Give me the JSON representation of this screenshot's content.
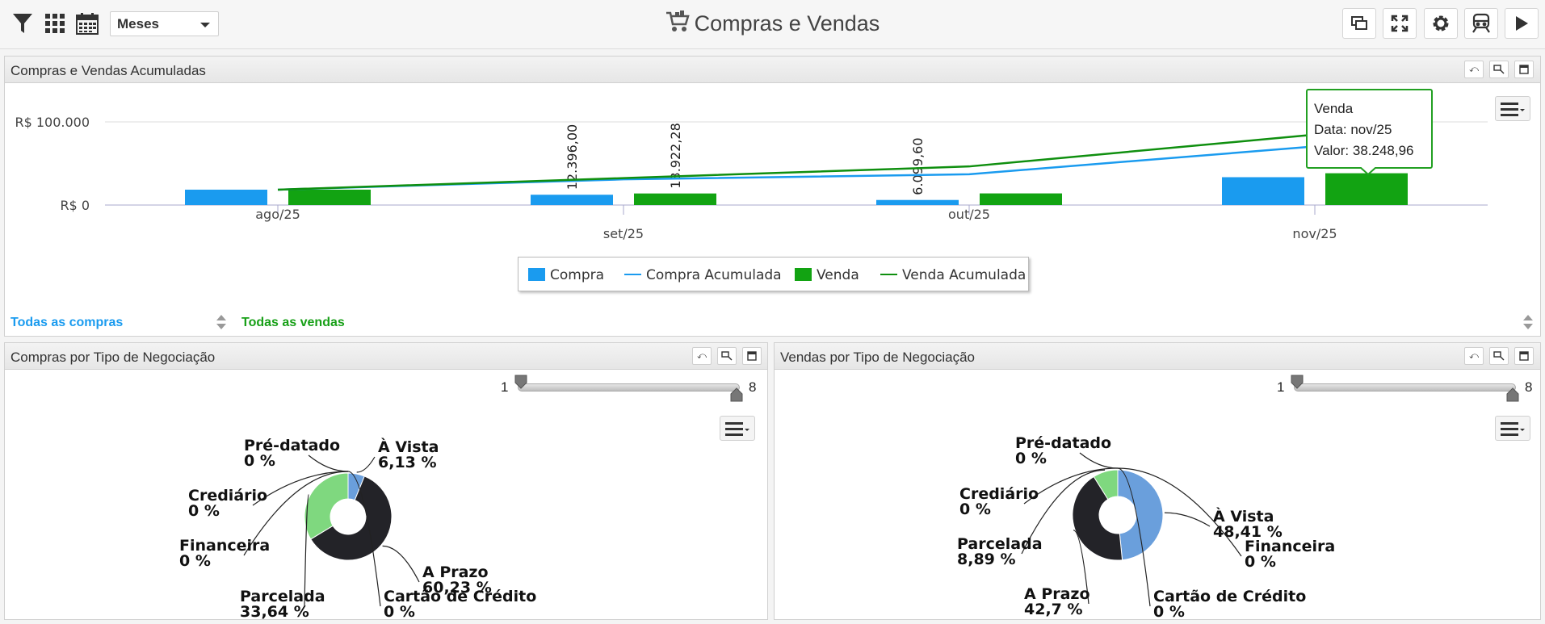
{
  "toolbar": {
    "period_select": "Meses",
    "title": "Compras e Vendas",
    "icons": [
      "filter-icon",
      "grid-icon",
      "calendar-icon",
      "cart-icon",
      "windows-icon",
      "fullscreen-icon",
      "gear-icon",
      "train-icon",
      "play-icon"
    ]
  },
  "panel_main": {
    "title": "Compras e Vendas Acumuladas",
    "link_compras": "Todas as compras",
    "link_vendas": "Todas as vendas"
  },
  "tooltip": {
    "series": "Venda",
    "data_label": "Data: nov/25",
    "valor_label": "Valor: 38.248,96"
  },
  "colors": {
    "compra": "#1a9bef",
    "compra_acumulada": "#1a9bef",
    "venda": "#12a312",
    "venda_acumulada": "#0f8f0f"
  },
  "chart_data": [
    {
      "type": "bar",
      "categories": [
        "ago/25",
        "set/25",
        "out/25",
        "nov/25"
      ],
      "yticks": [
        "R$ 0",
        "R$ 100.000"
      ],
      "ylim": [
        0,
        100000
      ],
      "series": [
        {
          "name": "Compra",
          "type": "bar",
          "values": [
            18500,
            12396,
            6099.6,
            33500
          ],
          "labels": [
            "",
            "12.396,00",
            "6.099,60",
            ""
          ]
        },
        {
          "name": "Venda",
          "type": "bar",
          "values": [
            18500,
            13922.28,
            14000,
            38248.96
          ],
          "labels": [
            "",
            "13.922,28",
            "",
            ""
          ]
        },
        {
          "name": "Compra Acumulada",
          "type": "line",
          "values": [
            18500,
            30896,
            36996,
            70496
          ]
        },
        {
          "name": "Venda Acumulada",
          "type": "line",
          "values": [
            18500,
            32422,
            46422,
            84671
          ]
        }
      ],
      "legend": [
        "Compra",
        "Compra Acumulada",
        "Venda",
        "Venda Acumulada"
      ],
      "legend_position": "bottom"
    },
    {
      "type": "pie",
      "title": "Compras por Tipo de Negociação",
      "slider": {
        "min_label": "1",
        "max_label": "8"
      },
      "slices": [
        {
          "label": "À Vista",
          "pct_label": "6,13 %",
          "value": 6.13,
          "color": "#6a9fdc"
        },
        {
          "label": "A Prazo",
          "pct_label": "60,23 %",
          "value": 60.23,
          "color": "#232328"
        },
        {
          "label": "Parcelada",
          "pct_label": "33,64 %",
          "value": 33.64,
          "color": "#7fd87f"
        },
        {
          "label": "Cartão de Crédito",
          "pct_label": "0 %",
          "value": 0,
          "color": "#f4a460"
        },
        {
          "label": "Financeira",
          "pct_label": "0 %",
          "value": 0,
          "color": "#8085e9"
        },
        {
          "label": "Crediário",
          "pct_label": "0 %",
          "value": 0,
          "color": "#f15c80"
        },
        {
          "label": "Pré-datado",
          "pct_label": "0 %",
          "value": 0,
          "color": "#e4d354"
        }
      ]
    },
    {
      "type": "pie",
      "title": "Vendas por Tipo de Negociação",
      "slider": {
        "min_label": "1",
        "max_label": "8"
      },
      "slices": [
        {
          "label": "À Vista",
          "pct_label": "48,41 %",
          "value": 48.41,
          "color": "#6a9fdc"
        },
        {
          "label": "A Prazo",
          "pct_label": "42,7 %",
          "value": 42.7,
          "color": "#232328"
        },
        {
          "label": "Parcelada",
          "pct_label": "8,89 %",
          "value": 8.89,
          "color": "#7fd87f"
        },
        {
          "label": "Financeira",
          "pct_label": "0 %",
          "value": 0,
          "color": "#8085e9"
        },
        {
          "label": "Cartão de Crédito",
          "pct_label": "0 %",
          "value": 0,
          "color": "#f4a460"
        },
        {
          "label": "Crediário",
          "pct_label": "0 %",
          "value": 0,
          "color": "#f15c80"
        },
        {
          "label": "Pré-datado",
          "pct_label": "0 %",
          "value": 0,
          "color": "#e4d354"
        }
      ]
    }
  ]
}
